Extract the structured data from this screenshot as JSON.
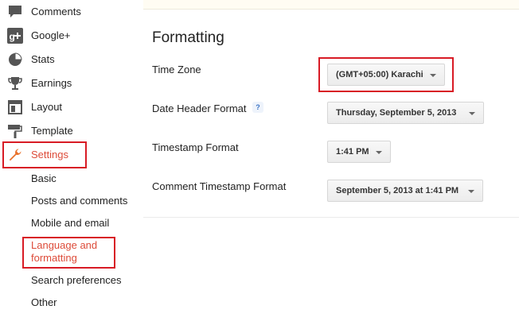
{
  "sidebar": {
    "items": [
      {
        "label": "Comments",
        "icon": "comments-icon"
      },
      {
        "label": "Google+",
        "icon": "google-plus-icon"
      },
      {
        "label": "Stats",
        "icon": "stats-icon"
      },
      {
        "label": "Earnings",
        "icon": "earnings-icon"
      },
      {
        "label": "Layout",
        "icon": "layout-icon"
      },
      {
        "label": "Template",
        "icon": "template-icon"
      },
      {
        "label": "Settings",
        "icon": "wrench-icon"
      }
    ],
    "settings_subitems": [
      {
        "label": "Basic"
      },
      {
        "label": "Posts and comments"
      },
      {
        "label": "Mobile and email"
      },
      {
        "label": "Language and formatting"
      },
      {
        "label": "Search preferences"
      },
      {
        "label": "Other"
      }
    ],
    "active_color": "#dd4b39"
  },
  "main": {
    "title": "Formatting",
    "rows": {
      "time_zone": {
        "label": "Time Zone",
        "value": "(GMT+05:00) Karachi"
      },
      "date_header": {
        "label": "Date Header Format",
        "help": "?",
        "value": "Thursday, September 5, 2013"
      },
      "timestamp": {
        "label": "Timestamp Format",
        "value": "1:41 PM"
      },
      "comment_timestamp": {
        "label": "Comment Timestamp Format",
        "value": "September 5, 2013 at 1:41 PM"
      }
    }
  },
  "highlight_color": "#d81b25"
}
